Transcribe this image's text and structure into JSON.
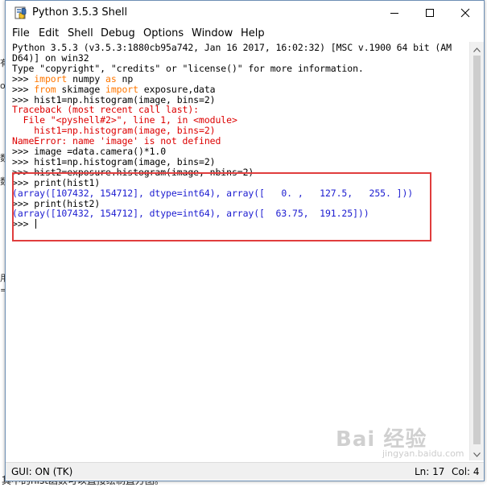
{
  "window": {
    "title": "Python 3.5.3 Shell"
  },
  "menu": [
    "File",
    "Edit",
    "Shell",
    "Debug",
    "Options",
    "Window",
    "Help"
  ],
  "shell_lines": [
    {
      "segments": [
        {
          "text": "Python 3.5.3 (v3.5.3:1880cb95a742, Jan 16 2017, 16:02:32) [MSC v.1900 64 bit (AM",
          "color": "black"
        }
      ]
    },
    {
      "segments": [
        {
          "text": "D64)] on win32",
          "color": "black"
        }
      ]
    },
    {
      "segments": [
        {
          "text": "Type \"copyright\", \"credits\" or \"license()\" for more information.",
          "color": "black"
        }
      ]
    },
    {
      "segments": [
        {
          "text": ">>> ",
          "color": "black"
        },
        {
          "text": "import",
          "color": "orange"
        },
        {
          "text": " numpy ",
          "color": "black"
        },
        {
          "text": "as",
          "color": "orange"
        },
        {
          "text": " np",
          "color": "black"
        }
      ]
    },
    {
      "segments": [
        {
          "text": ">>> ",
          "color": "black"
        },
        {
          "text": "from",
          "color": "orange"
        },
        {
          "text": " skimage ",
          "color": "black"
        },
        {
          "text": "import",
          "color": "orange"
        },
        {
          "text": " exposure,data",
          "color": "black"
        }
      ]
    },
    {
      "segments": [
        {
          "text": ">>> hist1=np.histogram(image, bins=2)",
          "color": "black"
        }
      ]
    },
    {
      "segments": [
        {
          "text": "Traceback (most recent call last):",
          "color": "red"
        }
      ]
    },
    {
      "segments": [
        {
          "text": "  File \"<pyshell#2>\", line 1, in <module>",
          "color": "red"
        }
      ]
    },
    {
      "segments": [
        {
          "text": "    hist1=np.histogram(image, bins=2)",
          "color": "red"
        }
      ]
    },
    {
      "segments": [
        {
          "text": "NameError: name 'image' is not defined",
          "color": "red"
        }
      ]
    },
    {
      "segments": [
        {
          "text": ">>> image =data.camera()*1.0",
          "color": "black"
        }
      ]
    },
    {
      "segments": [
        {
          "text": ">>> hist1=np.histogram(image, bins=2)",
          "color": "black"
        }
      ]
    },
    {
      "segments": [
        {
          "text": ">>> hist2=exposure.histogram(image, nbins=2)",
          "color": "black"
        }
      ]
    },
    {
      "segments": [
        {
          "text": ">>> print(hist1)",
          "color": "black"
        }
      ]
    },
    {
      "segments": [
        {
          "text": "(array([107432, 154712], dtype=int64), array([   0. ,   127.5,   255. ]))",
          "color": "blue"
        }
      ]
    },
    {
      "segments": [
        {
          "text": ">>> print(hist2)",
          "color": "black"
        }
      ]
    },
    {
      "segments": [
        {
          "text": "(array([107432, 154712], dtype=int64), array([  63.75,  191.25]))",
          "color": "blue"
        }
      ]
    },
    {
      "segments": [
        {
          "text": ">>> ",
          "color": "black"
        }
      ],
      "cursor": true
    }
  ],
  "status": {
    "left": "GUI: ON (TK)",
    "ln": "Ln: 17",
    "col": "Col: 4"
  },
  "background": {
    "caption": "其中的hist函数可以直接绘制直方图。",
    "fragments": [
      "有",
      "os",
      "数",
      "数",
      "用",
      "="
    ]
  },
  "watermark": "Bai 经验",
  "watermark_sub": "jingyan.baidu.com",
  "colors": {
    "black": "#000000",
    "orange": "#ff7700",
    "red": "#dd0000",
    "blue": "#1c1cd0",
    "highlight_box": "#e03d3d"
  },
  "icons": [
    "python-idle-icon",
    "minimize-icon",
    "maximize-icon",
    "close-icon",
    "scroll-up-icon",
    "scroll-down-icon"
  ]
}
